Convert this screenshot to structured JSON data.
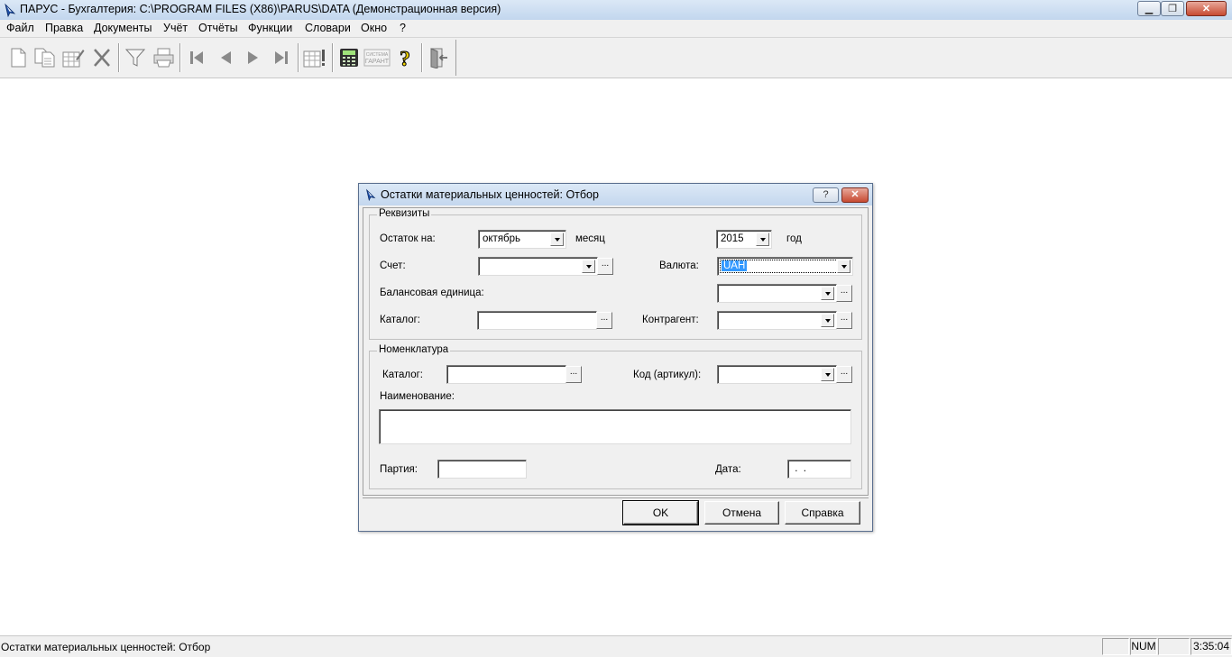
{
  "window": {
    "title": "ПАРУС - Бухгалтерия: C:\\PROGRAM FILES (X86)\\PARUS\\DATA (Демонстрационная версия)",
    "minimize_label": "▁",
    "maximize_label": "❐",
    "close_label": "✕"
  },
  "menu": [
    {
      "label": "Файл"
    },
    {
      "label": "Правка"
    },
    {
      "label": "Документы"
    },
    {
      "label": "Учёт"
    },
    {
      "label": "Отчёты"
    },
    {
      "label": "Функции"
    },
    {
      "label": "Словари"
    },
    {
      "label": "Окно"
    },
    {
      "label": "?"
    }
  ],
  "toolbar": {
    "buttons": [
      {
        "icon": "new-document-icon"
      },
      {
        "icon": "copy-document-icon"
      },
      {
        "icon": "edit-document-icon"
      },
      {
        "icon": "delete-icon"
      },
      {
        "icon": "filter-icon"
      },
      {
        "icon": "print-icon"
      },
      {
        "icon": "first-record-icon"
      },
      {
        "icon": "previous-record-icon"
      },
      {
        "icon": "next-record-icon"
      },
      {
        "icon": "last-record-icon"
      },
      {
        "icon": "table-alert-icon"
      },
      {
        "icon": "calculator-icon"
      },
      {
        "icon": "garant-system-icon"
      },
      {
        "icon": "help-icon"
      },
      {
        "icon": "exit-icon"
      }
    ],
    "garant_text_top": "СИСТЕМА",
    "garant_text_bottom": "ГАРАНТ"
  },
  "dialog": {
    "title": "Остатки материальных ценностей: Отбор",
    "help_label": "?",
    "close_label": "✕",
    "requisites": {
      "legend": "Реквизиты",
      "balance_on_label": "Остаток на:",
      "month_value": "октябрь",
      "month_label": "месяц",
      "year_value": "2015",
      "year_label": "год",
      "account_label": "Счет:",
      "account_value": "",
      "currency_label": "Валюта:",
      "currency_value": "UAH",
      "balance_unit_label": "Балансовая единица:",
      "balance_unit_value": "",
      "catalog_label": "Каталог:",
      "catalog_value": "",
      "contractor_label": "Контрагент:",
      "contractor_value": ""
    },
    "nomenclature": {
      "legend": "Номенклатура",
      "catalog_label": "Каталог:",
      "catalog_value": "",
      "code_label": "Код (артикул):",
      "code_value": "",
      "name_label": "Наименование:",
      "name_value": "",
      "batch_label": "Партия:",
      "batch_value": "",
      "date_label": "Дата:",
      "date_value": " .  ."
    },
    "ellipsis": "...",
    "buttons": {
      "ok": "OK",
      "cancel": "Отмена",
      "help": "Справка"
    }
  },
  "statusbar": {
    "text": "Остатки материальных ценностей: Отбор",
    "num": "NUM",
    "time": "3:35:04"
  }
}
